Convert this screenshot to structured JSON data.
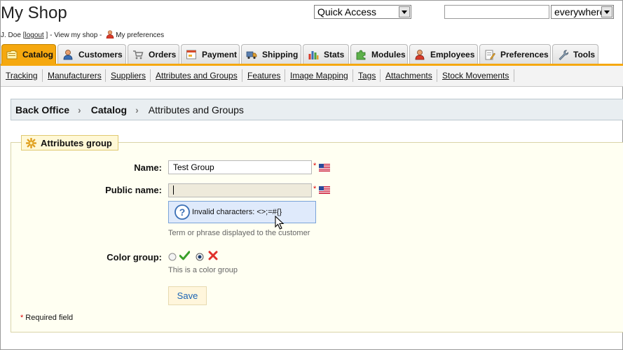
{
  "header": {
    "shop_title": "My Shop",
    "user_name": "J. Doe",
    "bracket_open": "[",
    "logout": "logout",
    "bracket_close": "]",
    "sep1": "-",
    "view_shop": "View my shop",
    "sep2": "-",
    "preferences": "My preferences",
    "quick_access": "Quick Access",
    "search_value": "",
    "search_scope": "everywhere"
  },
  "tabs": [
    {
      "label": "Catalog",
      "icon": "folder-icon",
      "active": true
    },
    {
      "label": "Customers",
      "icon": "person-icon"
    },
    {
      "label": "Orders",
      "icon": "cart-icon"
    },
    {
      "label": "Payment",
      "icon": "payment-icon"
    },
    {
      "label": "Shipping",
      "icon": "truck-icon"
    },
    {
      "label": "Stats",
      "icon": "bar-chart-icon"
    },
    {
      "label": "Modules",
      "icon": "puzzle-icon"
    },
    {
      "label": "Employees",
      "icon": "employee-icon"
    },
    {
      "label": "Preferences",
      "icon": "document-pencil-icon"
    },
    {
      "label": "Tools",
      "icon": "wrench-icon"
    }
  ],
  "subnav": [
    "Tracking",
    "Manufacturers",
    "Suppliers",
    "Attributes and Groups",
    "Features",
    "Image Mapping",
    "Tags",
    "Attachments",
    "Stock Movements"
  ],
  "breadcrumb": {
    "root": "Back Office",
    "section": "Catalog",
    "current": "Attributes and Groups"
  },
  "form": {
    "legend": "Attributes group",
    "name_label": "Name:",
    "name_value": "Test Group",
    "public_name_label": "Public name:",
    "public_name_value": "",
    "required_star": "*",
    "hint": "Invalid characters: <>;=#{}",
    "public_name_help": "Term or phrase displayed to the customer",
    "color_group_label": "Color group:",
    "color_group_selected": "no",
    "color_group_help": "This is a color group",
    "save_label": "Save",
    "required_note": "Required field"
  },
  "colors": {
    "tab_active": "#f5a80f",
    "fieldset_bg": "#fffff2",
    "breadcrumb_bg": "#e9eef1",
    "hint_bg": "#dfeafb",
    "save_text": "#1a63b5"
  }
}
